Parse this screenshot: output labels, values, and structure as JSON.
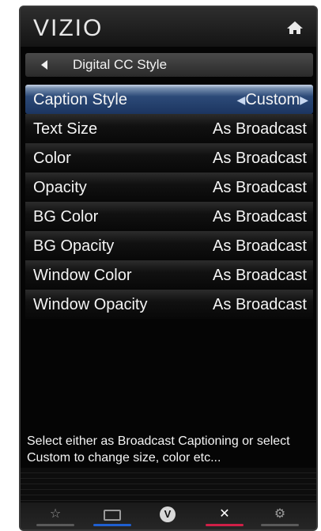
{
  "header": {
    "brand": "VIZIO",
    "home_icon": "home-icon"
  },
  "nav": {
    "title": "Digital CC Style",
    "back_icon": "back-arrow-icon"
  },
  "menu": {
    "items": [
      {
        "label": "Caption Style",
        "value": "Custom",
        "selected": true
      },
      {
        "label": "Text Size",
        "value": "As Broadcast"
      },
      {
        "label": "Color",
        "value": "As Broadcast"
      },
      {
        "label": "Opacity",
        "value": "As Broadcast"
      },
      {
        "label": "BG Color",
        "value": "As Broadcast"
      },
      {
        "label": "BG Opacity",
        "value": "As Broadcast"
      },
      {
        "label": "Window Color",
        "value": "As Broadcast"
      },
      {
        "label": "Window Opacity",
        "value": "As Broadcast"
      }
    ]
  },
  "help": {
    "text": "Select either as Broadcast Captioning or select Custom to change size, color etc..."
  },
  "footer": {
    "buttons": [
      {
        "name": "favorite-star-icon",
        "glyph": "☆"
      },
      {
        "name": "tv-input-icon",
        "glyph": ""
      },
      {
        "name": "vizio-v-icon",
        "glyph": "V"
      },
      {
        "name": "close-icon",
        "glyph": "✕"
      },
      {
        "name": "settings-gear-icon",
        "glyph": "⚙"
      }
    ]
  },
  "colors": {
    "accent_blue": "#2c4a78",
    "red": "#d01f47",
    "blue": "#1f5fd0"
  }
}
